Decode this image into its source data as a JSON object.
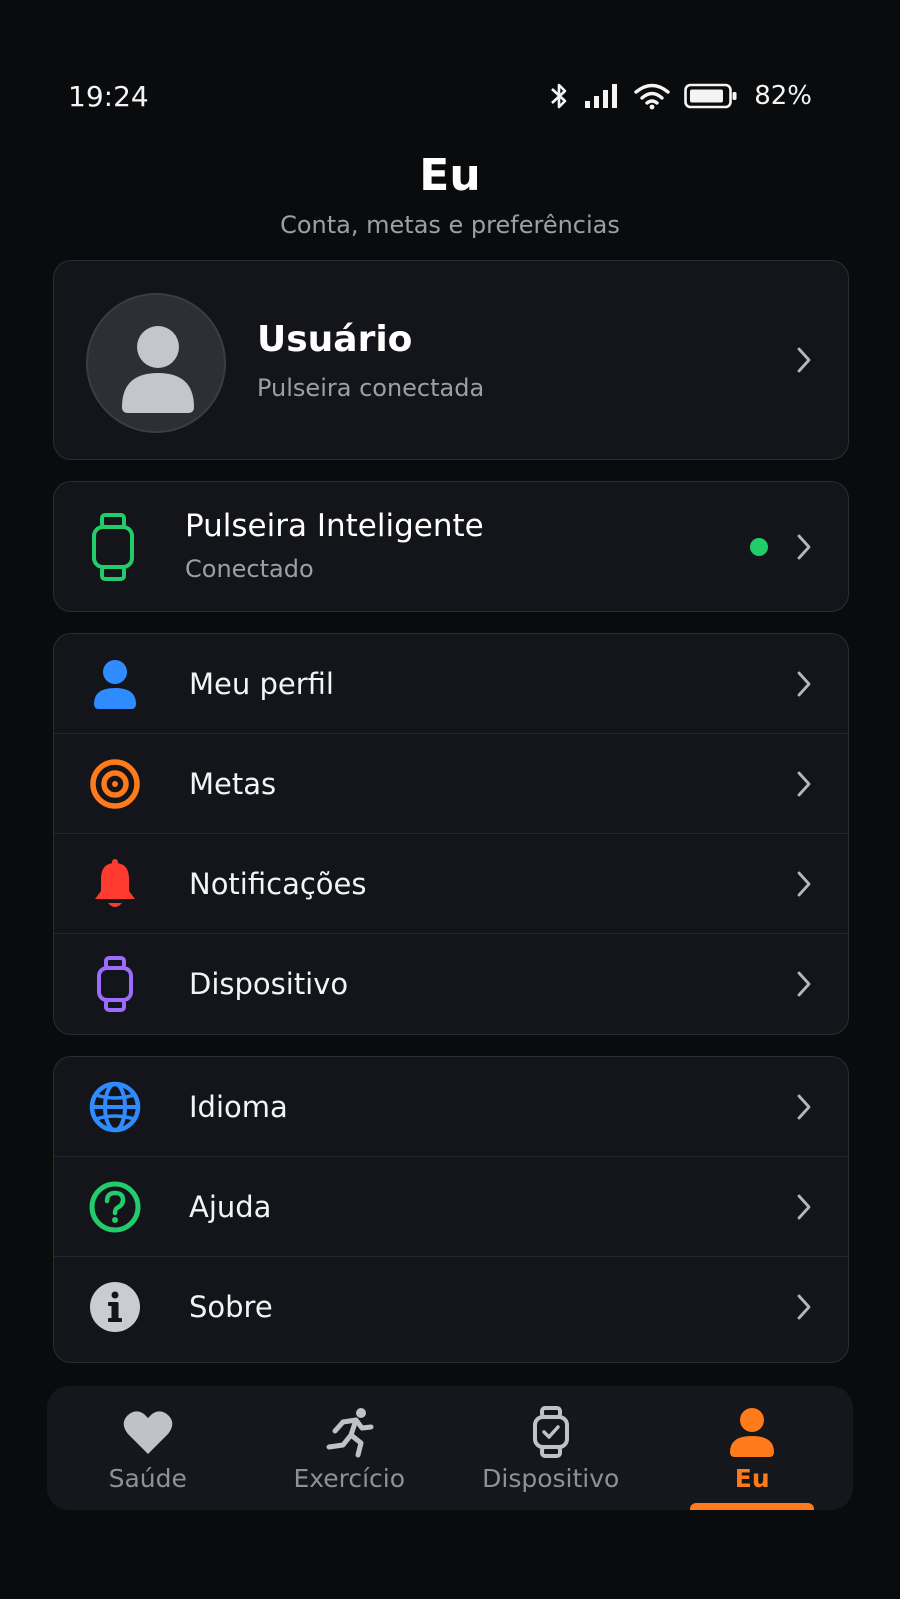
{
  "status_bar": {
    "time": "19:24",
    "battery_percent": "82%",
    "icons": [
      "bluetooth-icon",
      "signal-icon",
      "wifi-icon",
      "battery-icon"
    ]
  },
  "header": {
    "title": "Eu",
    "subtitle": "Conta, metas e preferências"
  },
  "profile": {
    "name": "Usuário",
    "status": "Pulseira conectada"
  },
  "device": {
    "name": "Pulseira Inteligente",
    "status": "Conectado",
    "status_color": "#22cc6a"
  },
  "settings_group_1": [
    {
      "label": "Meu perfil",
      "icon": "person-icon",
      "color": "#2f8cff"
    },
    {
      "label": "Metas",
      "icon": "target-icon",
      "color": "#ff7a1a"
    },
    {
      "label": "Notificações",
      "icon": "bell-icon",
      "color": "#ff3b30"
    },
    {
      "label": "Dispositivo",
      "icon": "watch-icon",
      "color": "#9b6cff"
    }
  ],
  "settings_group_2": [
    {
      "label": "Idioma",
      "icon": "globe-icon",
      "color": "#2f8cff"
    },
    {
      "label": "Ajuda",
      "icon": "help-icon",
      "color": "#22cc6a"
    },
    {
      "label": "Sobre",
      "icon": "info-icon",
      "color": "#c9ccd1"
    }
  ],
  "bottom_nav": {
    "items": [
      {
        "label": "Saúde",
        "icon": "heart-icon"
      },
      {
        "label": "Exercício",
        "icon": "running-icon"
      },
      {
        "label": "Dispositivo",
        "icon": "watch-icon"
      },
      {
        "label": "Eu",
        "icon": "person-icon"
      }
    ],
    "active": "Eu",
    "accent_color": "#ff7a1a"
  }
}
